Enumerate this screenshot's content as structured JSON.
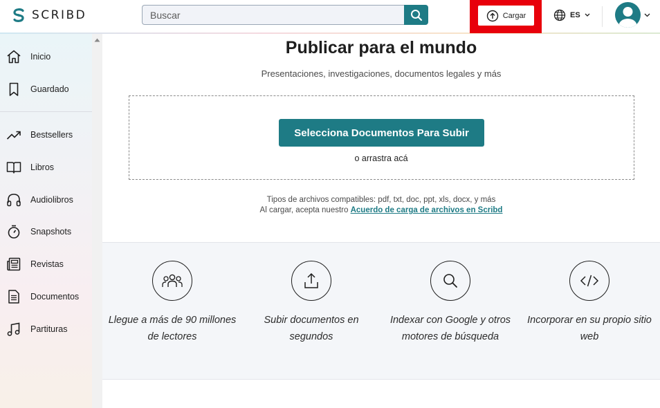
{
  "header": {
    "logo_text": "SCRIBD",
    "search_placeholder": "Buscar",
    "upload_label": "Cargar",
    "language": "ES"
  },
  "sidebar": {
    "items": [
      {
        "label": "Inicio",
        "icon": "home-icon"
      },
      {
        "label": "Guardado",
        "icon": "bookmark-icon"
      },
      {
        "label": "Bestsellers",
        "icon": "trending-icon"
      },
      {
        "label": "Libros",
        "icon": "book-icon"
      },
      {
        "label": "Audiolibros",
        "icon": "headphones-icon"
      },
      {
        "label": "Snapshots",
        "icon": "stopwatch-icon"
      },
      {
        "label": "Revistas",
        "icon": "magazine-icon"
      },
      {
        "label": "Documentos",
        "icon": "document-icon"
      },
      {
        "label": "Partituras",
        "icon": "music-note-icon"
      }
    ]
  },
  "main": {
    "title": "Publicar para el mundo",
    "subtitle": "Presentaciones, investigaciones, documentos legales y más",
    "select_button": "Selecciona Documentos Para Subir",
    "drag_text": "o arrastra acá",
    "file_types": "Tipos de archivos compatibles: pdf, txt, doc, ppt, xls, docx, y más",
    "terms_prefix": "Al cargar, acepta nuestro ",
    "terms_link": "Acuerdo de carga de archivos en Scribd"
  },
  "features": [
    {
      "text": "Llegue a más de 90 millones de lectores",
      "icon": "people-icon"
    },
    {
      "text": "Subir documentos en segundos",
      "icon": "upload-icon"
    },
    {
      "text": "Indexar con Google y otros motores de búsqueda",
      "icon": "search-icon"
    },
    {
      "text": "Incorporar en su propio sitio web",
      "icon": "code-icon"
    }
  ],
  "colors": {
    "accent": "#1e7b85",
    "highlight": "#e8000b"
  }
}
